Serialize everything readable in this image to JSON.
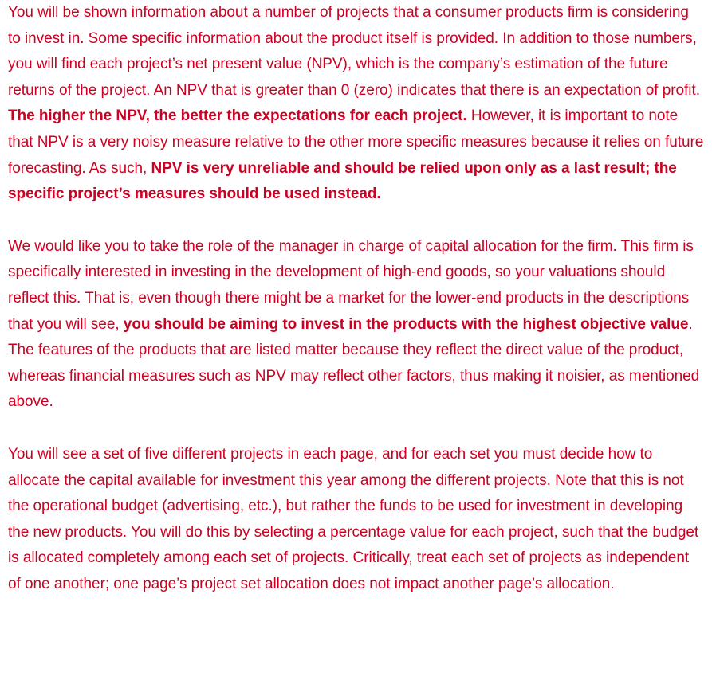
{
  "paragraphs": [
    {
      "segments": [
        {
          "text": "You will be shown information about a number of projects that a consumer products firm is considering to invest in. Some specific information about the product itself is provided. In addition to those numbers, you will find each project’s net present value (NPV), which is the company’s estimation of the future returns of the project. An NPV that is greater than 0 (zero) indicates that there is an expectation of profit. "
        },
        {
          "text": "The higher the NPV, the better the expectations for each project."
        },
        {
          "text": " However, it is important to note that NPV is a very noisy measure relative to the other more specific measures because it relies on future forecasting. As such, "
        },
        {
          "text": "NPV is very unreliable and should be relied upon only as a last result; the specific project’s measures should be used instead."
        }
      ]
    },
    {
      "segments": [
        {
          "text": "We would like you to take the role of the manager in charge of capital allocation for the firm. This firm is specifically interested in investing in the development of high-end goods, so your valuations should reflect this. That is, even though there might be a market for the lower-end products in the descriptions that you will see, "
        },
        {
          "text": "you should be aiming to invest in the products with the highest objective value"
        },
        {
          "text": ". The features of the products that are listed matter because they reflect the direct value of the product, whereas financial measures such as NPV may reflect other factors, thus making it noisier, as mentioned above."
        }
      ]
    },
    {
      "segments": [
        {
          "text": "You will see a set of five different projects in each page, and for each set you must decide how to allocate the capital available for investment this year among the different projects. Note that this is not the operational budget (advertising, etc.), but rather the funds to be used for investment in developing the new products. You will do this by selecting a percentage value for each project, such that the budget is allocated completely among each set of projects. Critically, treat each set of projects as independent of one another; one page’s project set allocation does not impact another page’s allocation."
        }
      ]
    }
  ],
  "colors": {
    "text": "#cc0022",
    "background": "#ffffff"
  }
}
